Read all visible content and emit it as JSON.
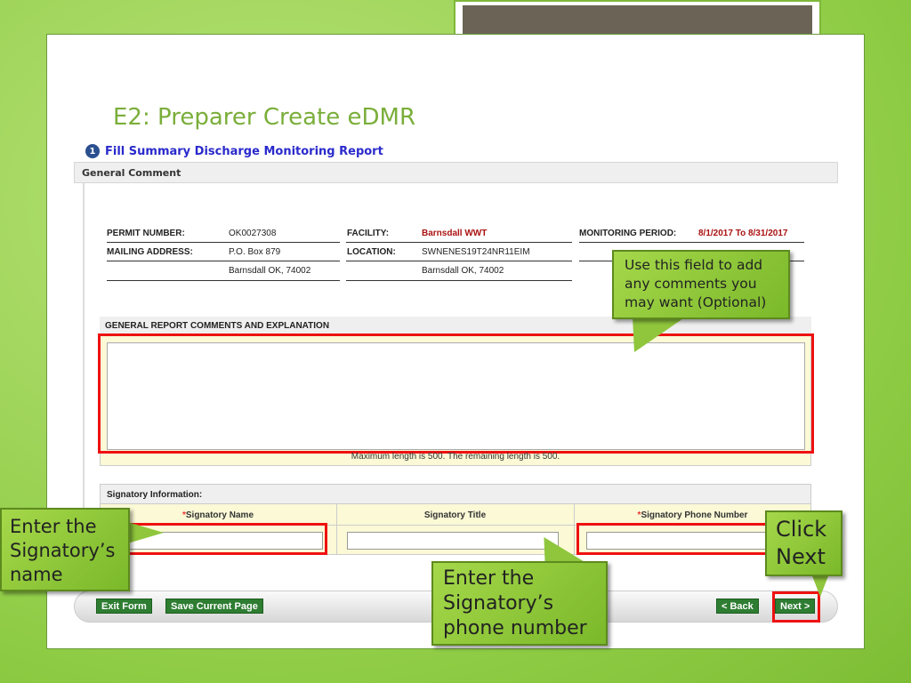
{
  "slide": {
    "title": "E2: Preparer Create eDMR"
  },
  "form": {
    "step_number": "1",
    "heading": "Fill Summary Discharge Monitoring Report",
    "section": "General Comment",
    "permit_label": "PERMIT NUMBER:",
    "permit_value": "OK0027308",
    "mailing_label": "MAILING ADDRESS:",
    "mailing_line1": "P.O. Box 879",
    "mailing_line2": "Barnsdall OK, 74002",
    "facility_label": "FACILITY:",
    "facility_value": "Barnsdall WWT",
    "location_label": "LOCATION:",
    "location_line1": "SWNENES19T24NR11EIM",
    "location_line2": "Barnsdall OK, 74002",
    "period_label": "MONITORING PERIOD:",
    "period_value": "8/1/2017 To 8/31/2017",
    "comments_header": "GENERAL REPORT COMMENTS AND EXPLANATION",
    "comments_value": "",
    "max_length_note": "Maximum length is 500. The remaining length is 500.",
    "signatory_header": "Signatory Information:",
    "required_mark": "*",
    "sig_name_label": "Signatory Name",
    "sig_title_label": "Signatory Title",
    "sig_phone_label": "Signatory Phone Number",
    "sig_name_value": "",
    "sig_title_value": "",
    "sig_phone_value": ""
  },
  "buttons": {
    "exit": "Exit Form",
    "save": "Save Current Page",
    "back": "< Back",
    "next": "Next >"
  },
  "callouts": {
    "comments": "Use this field to add any comments you may want (Optional)",
    "name": "Enter the Signatory’s name",
    "phone": "Enter the Signatory’s phone number",
    "next": "Click Next"
  },
  "colors": {
    "highlight": "#ee1111",
    "callout": "#8dc63f",
    "button": "#2e7d32",
    "title": "#7aae3a"
  }
}
